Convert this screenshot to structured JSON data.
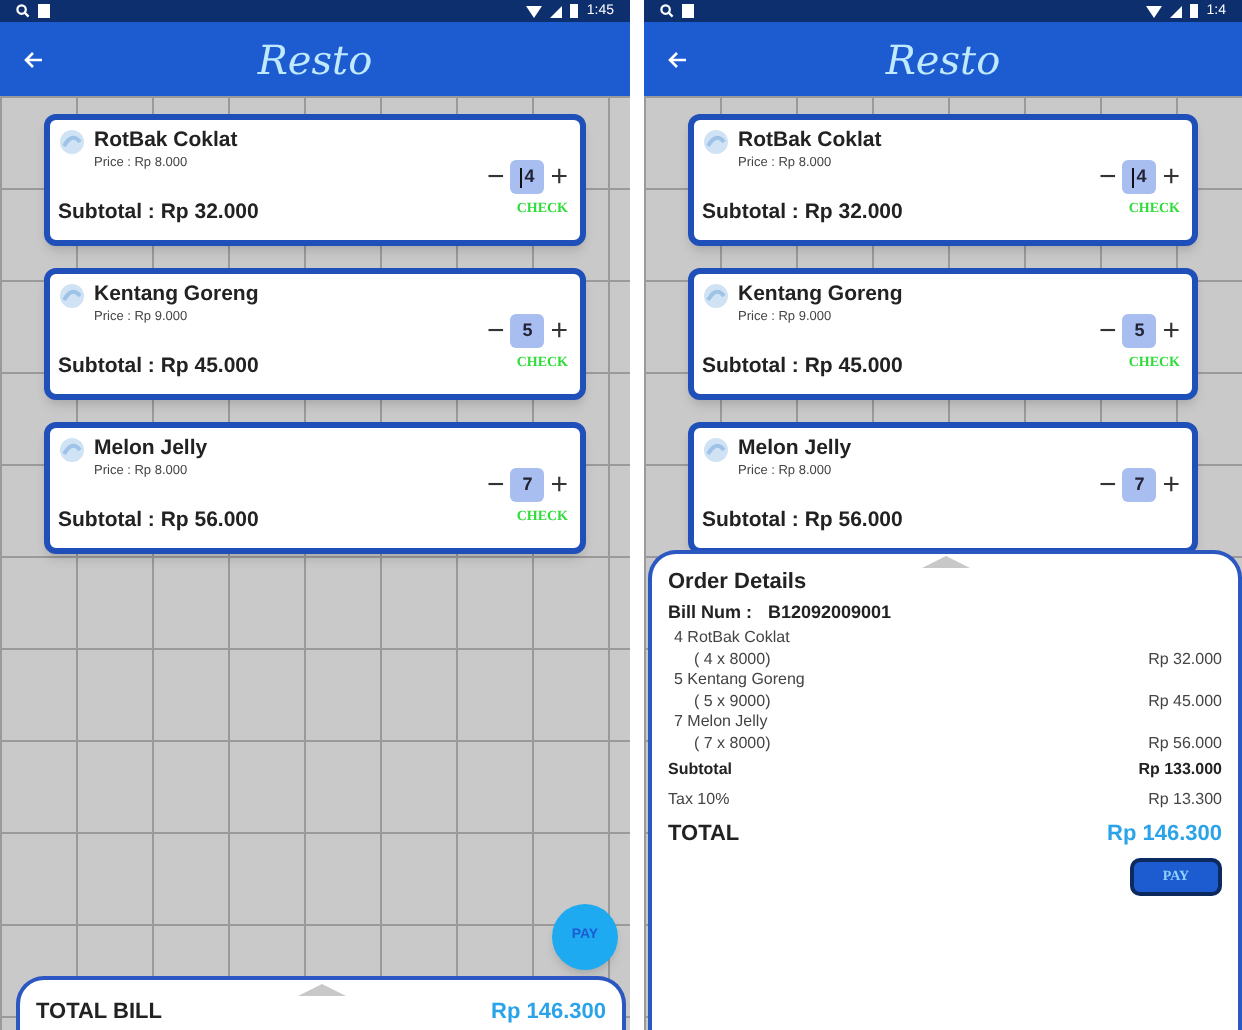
{
  "screens": [
    {
      "status_time": "1:45",
      "title": "Resto",
      "items": [
        {
          "name": "RotBak Coklat",
          "price": "Price : Rp 8.000",
          "subtotal": "Subtotal : Rp 32.000",
          "qty": "4",
          "focused": true,
          "minus": "−",
          "plus": "+",
          "check": "CHECK"
        },
        {
          "name": "Kentang Goreng",
          "price": "Price : Rp 9.000",
          "subtotal": "Subtotal : Rp 45.000",
          "qty": "5",
          "focused": false,
          "minus": "−",
          "plus": "+",
          "check": "CHECK"
        },
        {
          "name": "Melon Jelly",
          "price": "Price : Rp 8.000",
          "subtotal": "Subtotal : Rp 56.000",
          "qty": "7",
          "focused": false,
          "minus": "−",
          "plus": "+",
          "check": "CHECK"
        }
      ],
      "fab": "PAY",
      "sheet": {
        "kind": "collapsed",
        "total_label": "TOTAL BILL",
        "total_value": "Rp 146.300"
      }
    },
    {
      "status_time": "1:4",
      "title": "Resto",
      "items": [
        {
          "name": "RotBak Coklat",
          "price": "Price : Rp 8.000",
          "subtotal": "Subtotal : Rp 32.000",
          "qty": "4",
          "focused": true,
          "minus": "−",
          "plus": "+",
          "check": "CHECK"
        },
        {
          "name": "Kentang Goreng",
          "price": "Price : Rp 9.000",
          "subtotal": "Subtotal : Rp 45.000",
          "qty": "5",
          "focused": false,
          "minus": "−",
          "plus": "+",
          "check": "CHECK"
        },
        {
          "name": "Melon Jelly",
          "price": "Price : Rp 8.000",
          "subtotal": "Subtotal : Rp 56.000",
          "qty": "7",
          "focused": false,
          "minus": "−",
          "plus": "+"
        }
      ],
      "sheet": {
        "kind": "expanded",
        "title": "Order Details",
        "bill_label": "Bill Num :",
        "bill_number": "B12092009001",
        "lines": [
          {
            "item": "4 RotBak Coklat",
            "calc": "( 4 x 8000)",
            "amount": "Rp 32.000"
          },
          {
            "item": "5 Kentang Goreng",
            "calc": "( 5 x 9000)",
            "amount": "Rp 45.000"
          },
          {
            "item": "7 Melon Jelly",
            "calc": "( 7 x 8000)",
            "amount": "Rp 56.000"
          }
        ],
        "summary": [
          {
            "label": "Subtotal",
            "value": "Rp 133.000",
            "bold": true
          },
          {
            "label": "Tax 10%",
            "value": "Rp 13.300",
            "bold": false
          }
        ],
        "total_label": "TOTAL",
        "total_value": "Rp 146.300",
        "pay": "PAY"
      }
    }
  ]
}
